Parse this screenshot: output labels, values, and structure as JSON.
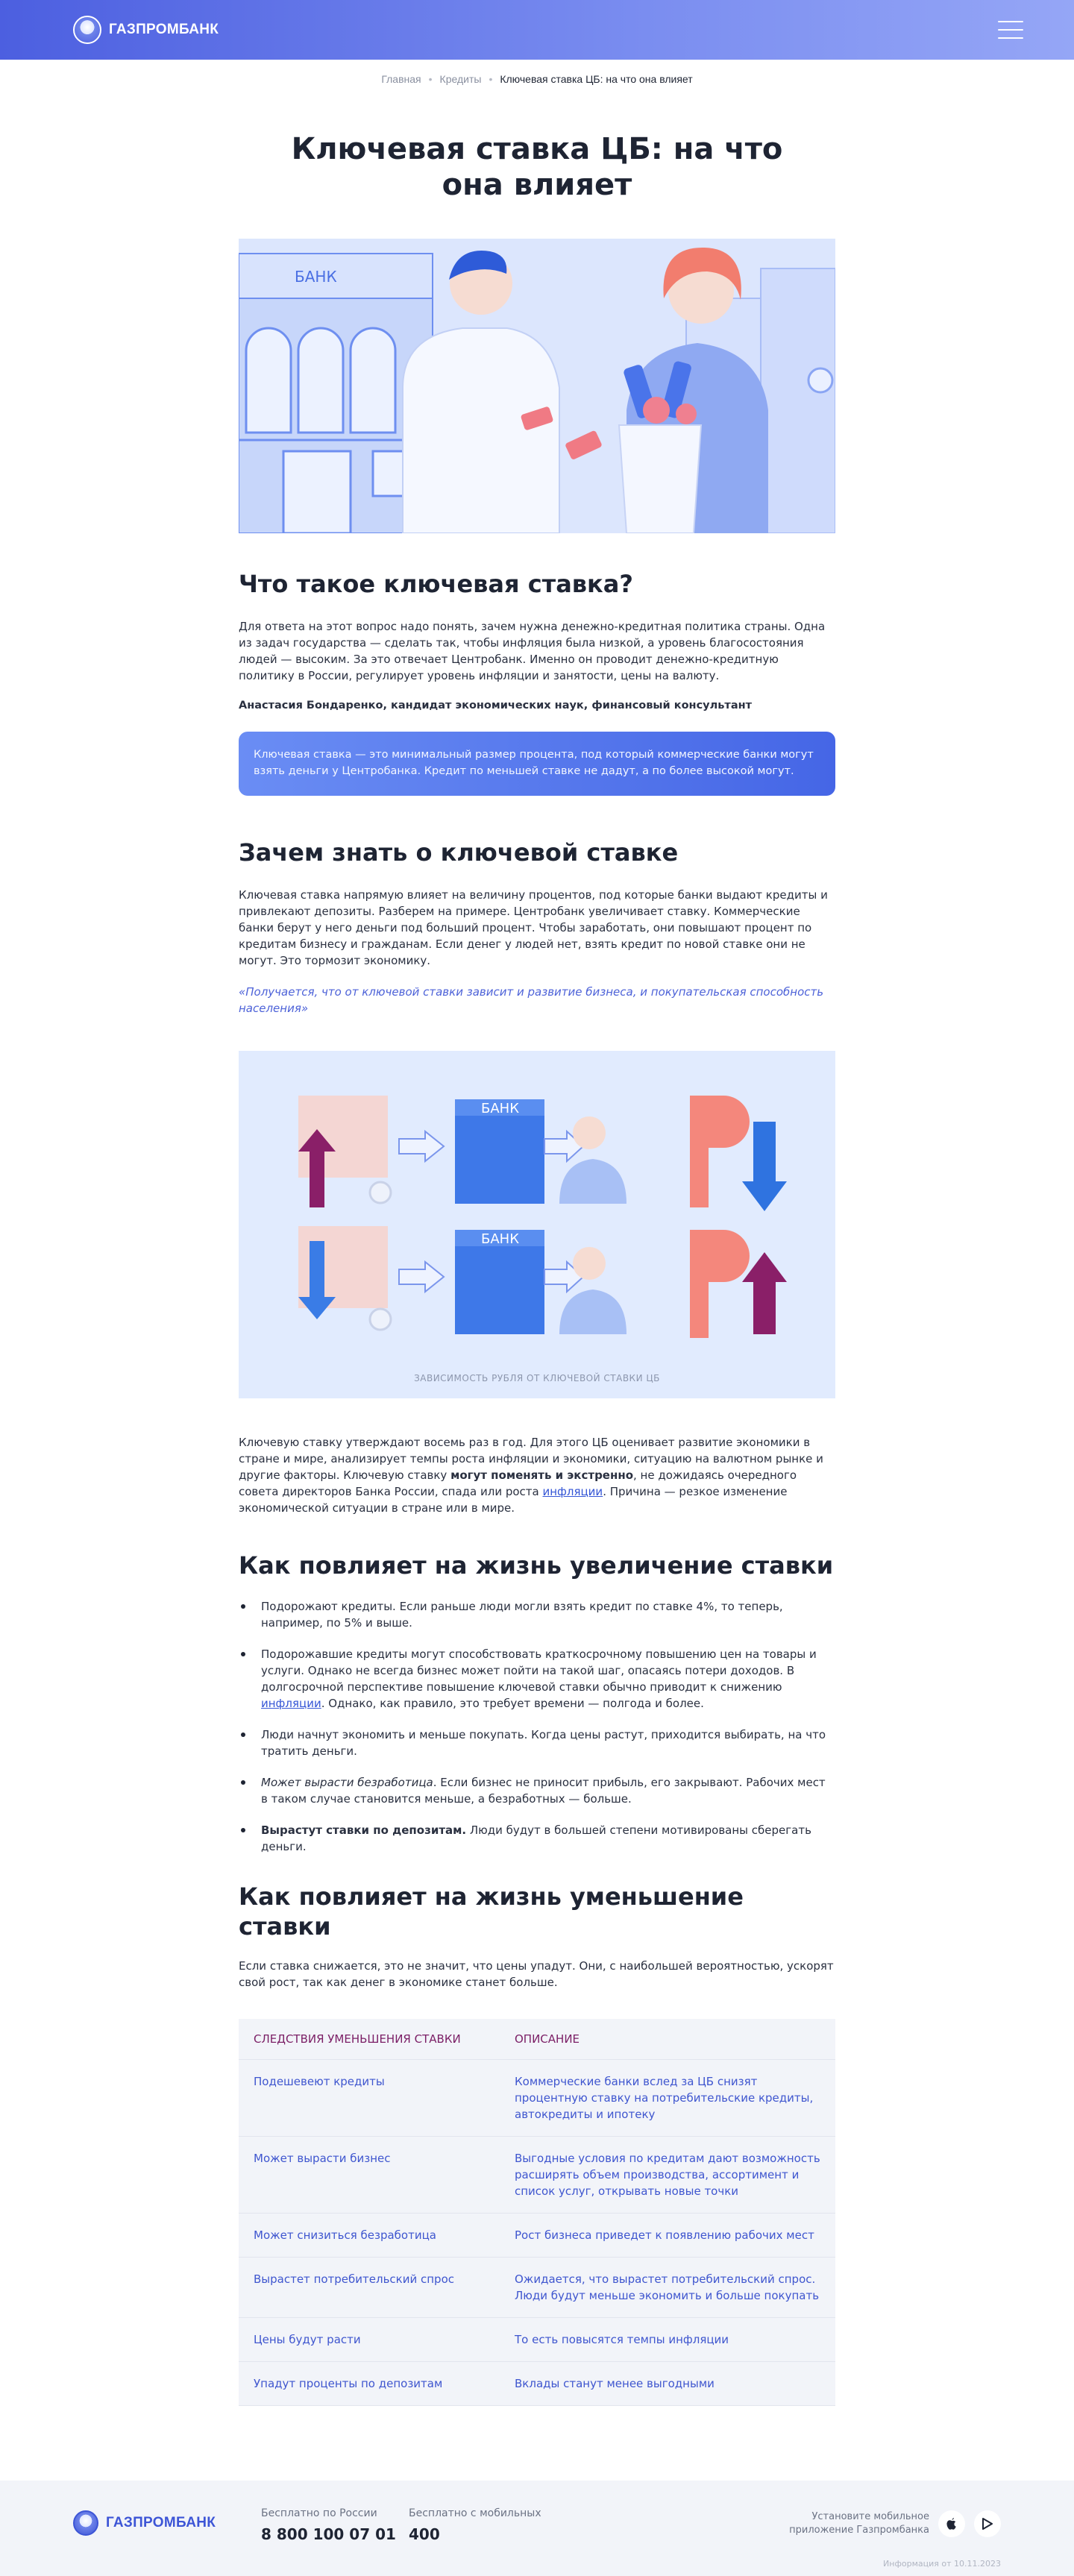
{
  "header": {
    "logo_text": "ГАЗПРОМБАНК",
    "menu_icon": "hamburger-menu-icon"
  },
  "breadcrumb": {
    "items": [
      "Главная",
      "Кредиты"
    ],
    "current": "Ключевая ставка ЦБ: на что она влияет"
  },
  "article": {
    "title": "Ключевая ставка ЦБ: на что она влияет",
    "hero_sign": "БАНК",
    "section1": {
      "heading": "Что такое ключевая ставка?",
      "paragraph": "Для ответа на этот вопрос надо понять, зачем нужна денежно-кредитная политика страны. Одна из задач государства — сделать так, чтобы инфляция была низкой, а уровень благосостояния людей — высоким. За это отвечает Центробанк. Именно он проводит денежно-кредитную политику в России, регулирует уровень инфляции и занятости, цены на валюту.",
      "author": "Анастасия Бондаренко, кандидат экономических наук, финансовый консультант",
      "definition": "Ключевая ставка — это минимальный размер процента, под который коммерческие банки могут взять деньги у Центробанка. Кредит по меньшей ставке не дадут, а по более высокой могут."
    },
    "section2": {
      "heading": "Зачем знать о ключевой ставке",
      "paragraph": "Ключевая ставка напрямую влияет на величину процентов, под которые банки выдают кредиты и привлекают депозиты. Разберем на примере. Центробанк увеличивает ставку. Коммерческие банки берут у него деньги под больший процент. Чтобы заработать, они повышают процент по кредитам бизнесу и гражданам. Если денег у людей нет, взять кредит по новой ставке они не могут. Это тормозит экономику.",
      "quote": "«Получается, что от ключевой ставки зависит и развитие бизнеса, и покупательская способность населения»",
      "scheme_bank_label": "БАНК",
      "scheme_caption": "ЗАВИСИМОСТЬ РУБЛЯ ОТ КЛЮЧЕВОЙ СТАВКИ ЦБ",
      "p2_part1": "Ключевую ставку утверждают восемь раз в год. Для этого ЦБ оценивает развитие экономики в стране и мире, анализирует темпы роста инфляции и экономики, ситуацию на валютном рынке и другие факторы. Ключевую ставку ",
      "p2_bold": "могут поменять и экстренно",
      "p2_part2": ", не дожидаясь очередного совета директоров Банка России, спада или роста ",
      "p2_link": "инфляции",
      "p2_part3": ". Причина — резкое изменение экономической ситуации в стране или в мире."
    },
    "section3": {
      "heading": "Как повлияет на жизнь увеличение ставки",
      "b1": "Подорожают кредиты. Если раньше люди могли взять кредит по ставке 4%, то теперь, например, по 5% и выше.",
      "b2_part1": "Подорожавшие кредиты могут способствовать краткосрочному повышению цен на товары и услуги. Однако не всегда бизнес может пойти на такой шаг, опасаясь потери доходов. В долгосрочной перспективе повышение ключевой ставки обычно приводит к снижению ",
      "b2_link": "инфляции",
      "b2_part2": ". Однако, как правило, это требует времени — полгода и более.",
      "b3": "Люди начнут экономить и меньше покупать. Когда цены растут, приходится выбирать, на что тратить деньги.",
      "b4_italic": "Может вырасти безработица",
      "b4_rest": ". Если бизнес не приносит прибыль, его закрывают. Рабочих мест в таком случае становится меньше, а безработных — больше.",
      "b5_bold": "Вырастут ставки по депозитам.",
      "b5_rest": " Люди будут в большей степени мотивированы сберегать деньги."
    },
    "section4": {
      "heading": "Как повлияет на жизнь уменьшение ставки",
      "paragraph": "Если ставка снижается, это не значит, что цены упадут. Они, с наибольшей вероятностью, ускорят свой рост, так как денег в экономике станет больше.",
      "table": {
        "col1": "Следствия уменьшения ставки",
        "col2": "Описание",
        "rows": [
          [
            "Подешевеют кредиты",
            "Коммерческие банки вслед за ЦБ снизят процентную ставку на потребительские кредиты, автокредиты и ипотеку"
          ],
          [
            "Может вырасти бизнес",
            "Выгодные условия по кредитам дают возможность расширять объем производства, ассортимент и список услуг, открывать новые точки"
          ],
          [
            "Может снизиться безработица",
            "Рост бизнеса приведет к появлению рабочих мест"
          ],
          [
            "Вырастет потребительский спрос",
            "Ожидается, что вырастет потребительский спрос. Люди будут меньше экономить и больше покупать"
          ],
          [
            "Цены будут расти",
            "То есть повысятся темпы инфляции"
          ],
          [
            "Упадут проценты по депозитам",
            "Вклады станут менее выгодными"
          ]
        ]
      }
    }
  },
  "footer": {
    "logo_text": "ГАЗПРОМБАНК",
    "phone1_label": "Бесплатно по России",
    "phone1": "8 800 100 07 01",
    "phone2_label": "Бесплатно с мобильных",
    "phone2": "400",
    "app_text_1": "Установите мобильное",
    "app_text_2": "приложение Газпромбанка",
    "app_store_icon": "apple-icon",
    "play_store_icon": "google-play-icon",
    "info_date": "Информация от 10.11.2023"
  }
}
